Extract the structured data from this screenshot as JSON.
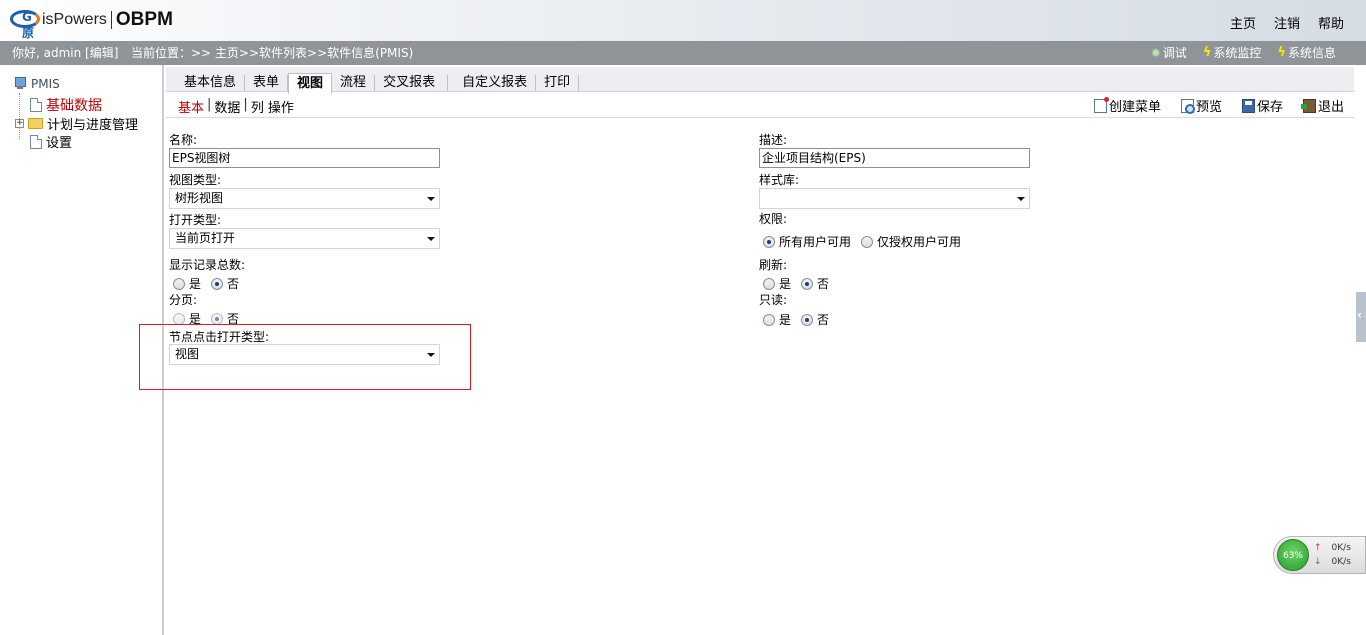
{
  "header": {
    "logo_mark": "G原",
    "logo_brand": "isPowers",
    "logo_product": "OBPM",
    "nav": [
      "主页",
      "注销",
      "帮助"
    ]
  },
  "infobar": {
    "greeting": "你好, admin [编辑]",
    "location": "当前位置：>> 主页>>软件列表>>软件信息(PMIS)",
    "tools": [
      {
        "label": "调试",
        "icon": "bug-icon"
      },
      {
        "label": "系统监控",
        "icon": "lightning-icon"
      },
      {
        "label": "系统信息",
        "icon": "lightning-icon"
      }
    ]
  },
  "tree": {
    "root": "PMIS",
    "items": [
      {
        "label": "基础数据",
        "selected": true
      },
      {
        "label": "计划与进度管理",
        "expandable": true
      },
      {
        "label": "设置"
      }
    ]
  },
  "tabs": [
    "基本信息",
    "表单",
    "视图",
    "流程",
    "交叉报表",
    "自定义报表",
    "打印"
  ],
  "active_tab": "视图",
  "subtabs": [
    "基本",
    "数据",
    "列",
    "操作"
  ],
  "actions": [
    "创建菜单",
    "预览",
    "保存",
    "退出"
  ],
  "form": {
    "name_label": "名称:",
    "name_value": "EPS视图树",
    "view_type_label": "视图类型:",
    "view_type_value": "树形视图",
    "open_type_label": "打开类型:",
    "open_type_value": "当前页打开",
    "show_count_label": "显示记录总数:",
    "paging_label": "分页:",
    "node_open_label": "节点点击打开类型:",
    "node_open_value": "视图",
    "desc_label": "描述:",
    "desc_value": "企业项目结构(EPS)",
    "style_label": "样式库:",
    "style_value": "",
    "perm_label": "权限:",
    "perm_all": "所有用户可用",
    "perm_auth": "仅授权用户可用",
    "refresh_label": "刷新:",
    "readonly_label": "只读:",
    "yes": "是",
    "no": "否"
  },
  "network": {
    "percent": "63%",
    "up": "0K/s",
    "down": "0K/s"
  },
  "colors": {
    "active_subtab": "#c00000",
    "highlight_box": "#d81e1e",
    "infobar": "#8f9499"
  }
}
